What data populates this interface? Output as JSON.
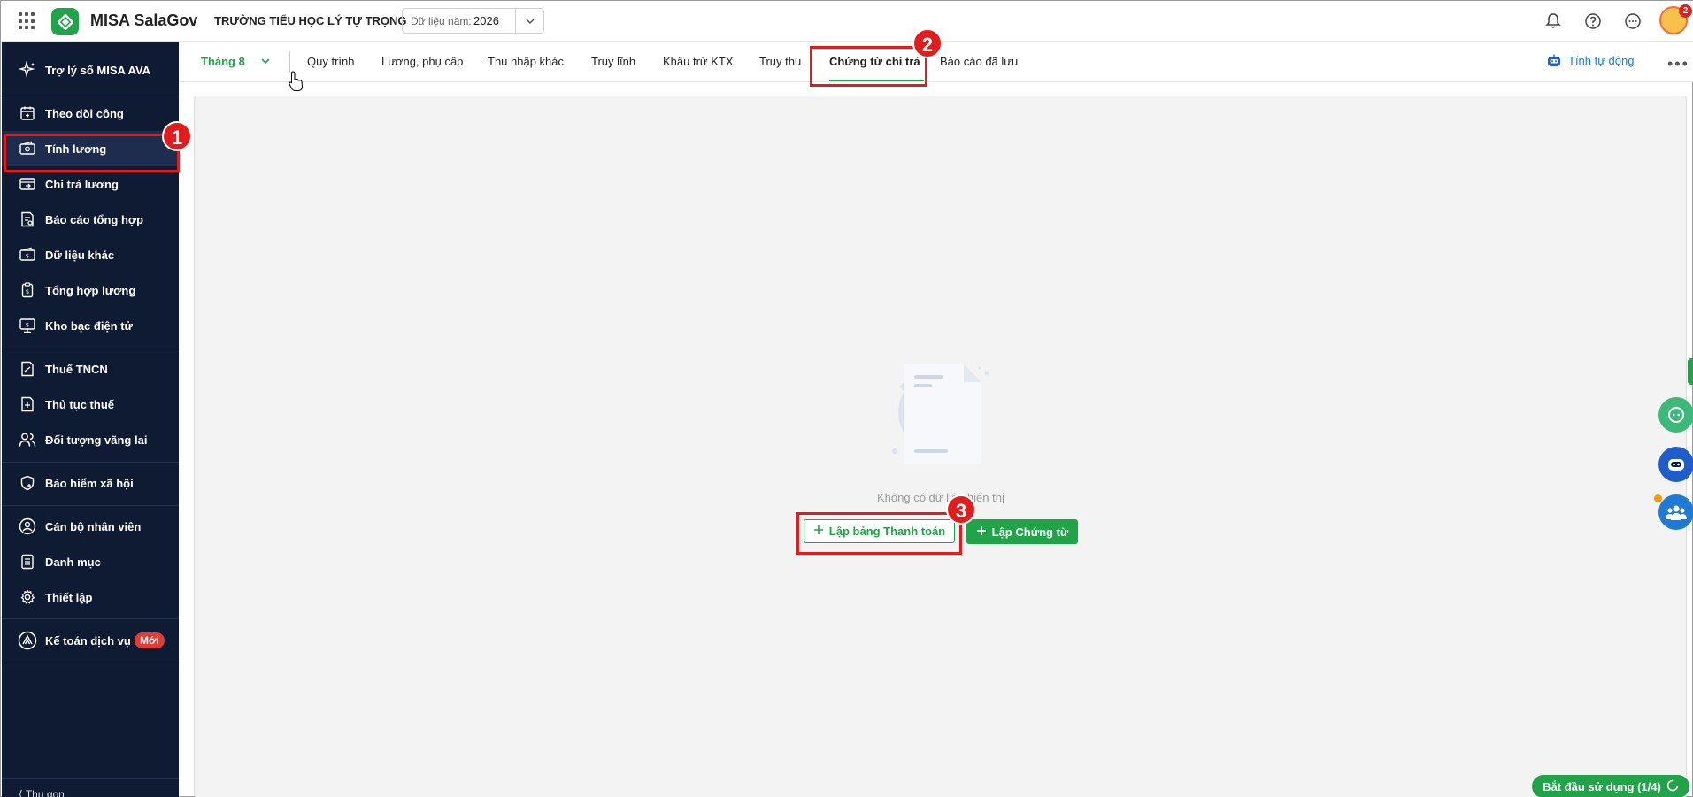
{
  "header": {
    "app_name": "MISA SalaGov",
    "school_name": "TRƯỜNG TIỂU HỌC LÝ TỰ TRỌNG",
    "year_label": "Dữ liệu năm:",
    "year_value": "2026",
    "avatar_badge": "2"
  },
  "sidebar": {
    "items": [
      {
        "label": "Trợ lý số MISA AVA",
        "icon": "sparkle-icon"
      },
      {
        "label": "Theo dõi công",
        "icon": "calendar-icon"
      },
      {
        "label": "Tính lương",
        "icon": "wallet-icon"
      },
      {
        "label": "Chi trả lương",
        "icon": "pay-icon"
      },
      {
        "label": "Báo cáo tổng hợp",
        "icon": "report-icon"
      },
      {
        "label": "Dữ liệu khác",
        "icon": "data-icon"
      },
      {
        "label": "Tổng hợp lương",
        "icon": "summary-icon"
      },
      {
        "label": "Kho bạc điện tử",
        "icon": "treasury-icon"
      },
      {
        "label": "Thuế TNCN",
        "icon": "tax-icon"
      },
      {
        "label": "Thủ tục thuế",
        "icon": "tax-procedure-icon"
      },
      {
        "label": "Đối tượng vãng lai",
        "icon": "people-icon"
      },
      {
        "label": "Bảo hiểm xã hội",
        "icon": "shield-icon"
      },
      {
        "label": "Cán bộ nhân viên",
        "icon": "staff-icon"
      },
      {
        "label": "Danh mục",
        "icon": "list-icon"
      },
      {
        "label": "Thiết lập",
        "icon": "gear-icon"
      },
      {
        "label": "Kế toán dịch vụ",
        "icon": "accounting-icon"
      }
    ],
    "new_badge": "Mới",
    "collapse_label": "Thu gọn"
  },
  "tabs": {
    "month": "Tháng 8",
    "items": [
      "Quy trình",
      "Lương, phụ cấp",
      "Thu nhập khác",
      "Truy lĩnh",
      "Khấu trừ KTX",
      "Truy thu",
      "Chứng từ chi trả",
      "Báo cáo đã lưu"
    ],
    "auto_calc": "Tính tự động"
  },
  "main": {
    "empty_text": "Không có dữ liệu hiển thị",
    "btn_payment_table": "Lập bảng Thanh toán",
    "btn_voucher": "Lập Chứng từ"
  },
  "markers": [
    "1",
    "2",
    "3"
  ],
  "footer": {
    "start_label": "Bắt đầu sử dụng (1/4)"
  },
  "colors": {
    "brand_green": "#21a34a",
    "sidebar_bg": "#0f1b33",
    "marker_red": "#e11c1c",
    "link_blue": "#1f7ad6"
  }
}
